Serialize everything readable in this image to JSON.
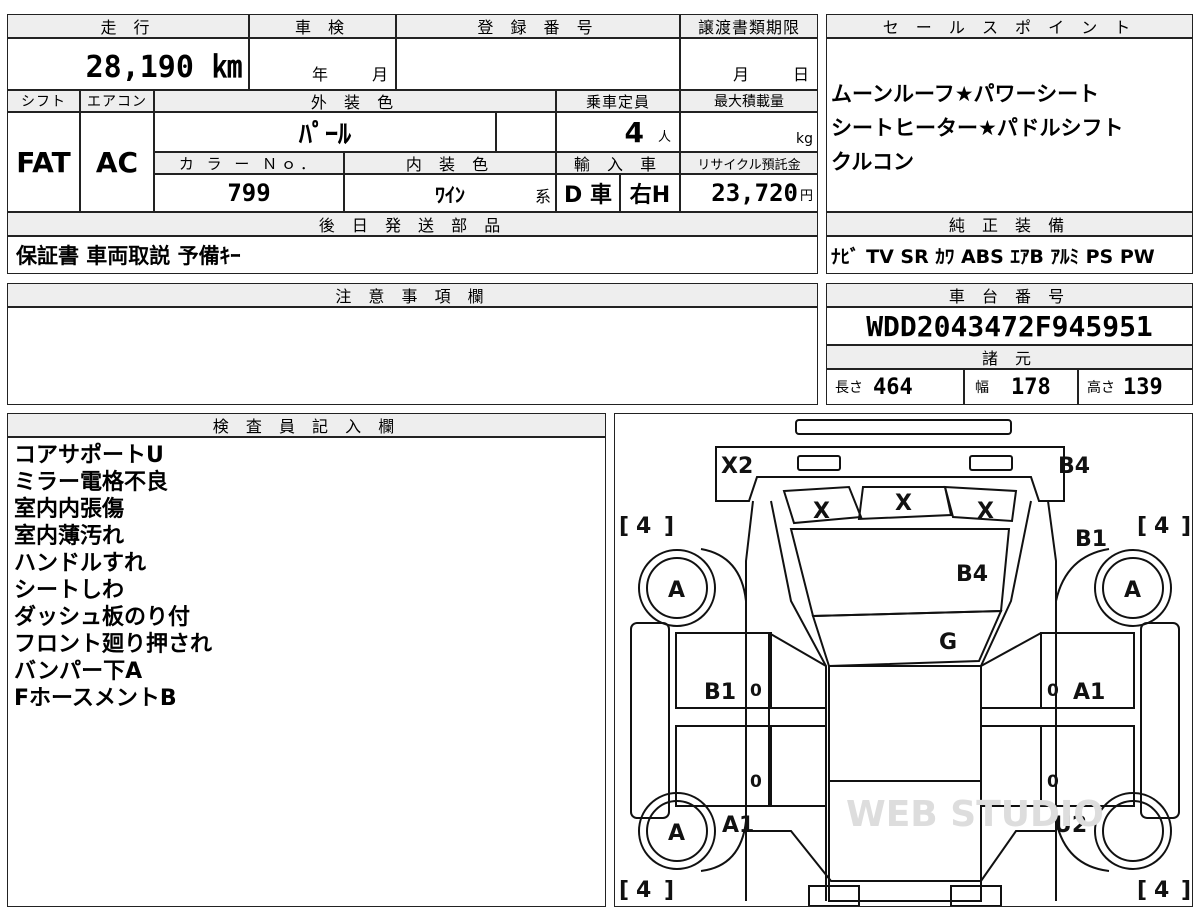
{
  "top_block": {
    "mileage_label": "走 行",
    "mileage_value": "28,190 ㎞",
    "shaken_label": "車 検",
    "shaken_year": "年",
    "shaken_month": "月",
    "reg_label": "登 録 番 号",
    "transfer_label": "譲渡書類期限",
    "transfer_month": "月",
    "transfer_day": "日",
    "shift_label": "シフト",
    "shift_value": "FAT",
    "ac_label": "エアコン",
    "ac_value": "AC",
    "exterior_label": "外 装 色",
    "exterior_value": "ﾊﾟｰﾙ",
    "capacity_label": "乗車定員",
    "capacity_value": "4",
    "capacity_unit": "人",
    "load_label": "最大積載量",
    "load_unit": "kg",
    "color_no_label": "カ ラ ー Ｎｏ．",
    "color_no_value": "799",
    "interior_label": "内 装 色",
    "interior_value": "ﾜｲﾝ",
    "interior_suffix": "系",
    "import_label": "輸 入 車",
    "import_car": "D 車",
    "steering": "右H",
    "recycle_label": "リサイクル預託金",
    "recycle_value": "23,720",
    "recycle_unit": "円",
    "later_parts_label": "後 日 発 送 部 品",
    "later_parts_value": "保証書 車両取説 予備ｷｰ"
  },
  "sales_points": {
    "label": "セ ー ル ス ポ イ ン ト",
    "lines": [
      "ムーンルーフ★パワーシート",
      "シートヒーター★パドルシフト",
      "クルコン"
    ]
  },
  "genuine_equipment": {
    "label": "純 正 装 備",
    "value": "ﾅﾋﾞ TV SR ｶﾜ ABS ｴｱB ｱﾙﾐ PS PW"
  },
  "caution": {
    "label": "注 意 事 項 欄"
  },
  "chassis": {
    "label": "車 台 番 号",
    "value": "WDD2043472F945951"
  },
  "specs": {
    "label": "諸 元",
    "length_label": "長さ",
    "length_value": "464",
    "width_label": "幅",
    "width_value": "178",
    "height_label": "高さ",
    "height_value": "139"
  },
  "inspector": {
    "label": "検 査 員 記 入 欄",
    "notes": [
      "コアサポートU",
      "ミラー電格不良",
      "室内内張傷",
      "室内薄汚れ",
      "ハンドルすれ",
      "シートしわ",
      "ダッシュ板のり付",
      "フロント廻り押され",
      "バンパー下A",
      "FホースメントB"
    ]
  },
  "diagram": {
    "marks": {
      "roof_front": "X2",
      "roof_rear": "B4",
      "win_left": "X",
      "win_center": "X",
      "win_right": "X",
      "hood": "B4",
      "windshield": "G",
      "front_left_door": "B1",
      "front_right_door": "A1",
      "right_fender": "B1",
      "rear_left": "A1",
      "rear_right": "U2",
      "wheel_fl": "A",
      "wheel_fr": "A",
      "wheel_rl": "A",
      "tire_fl": "4",
      "tire_fr": "4",
      "tire_rl": "4",
      "tire_rr": "4",
      "door_l1": "0",
      "door_r1": "0",
      "door_l2": "0",
      "door_r2": "0"
    },
    "watermark": "WEB STUDIO"
  }
}
